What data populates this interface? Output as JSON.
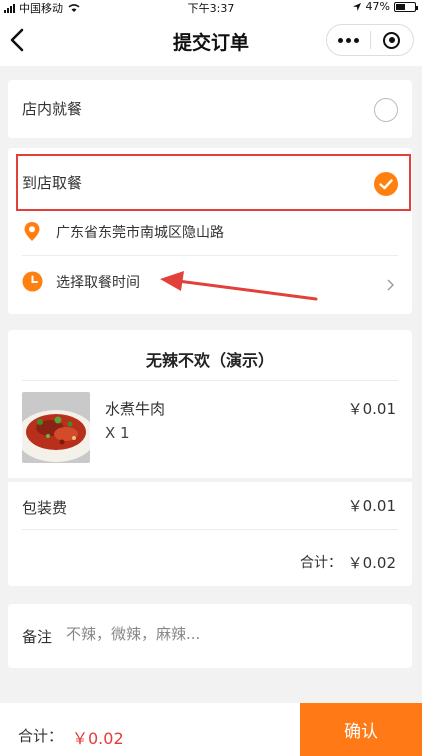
{
  "status_bar": {
    "carrier": "中国移动",
    "time": "下午3:37",
    "battery": "47%"
  },
  "navbar": {
    "title": "提交订单"
  },
  "dining_options": {
    "dine_in_label": "店内就餐",
    "pickup_label": "到店取餐",
    "selected": "pickup"
  },
  "pickup": {
    "address": "广东省东莞市南城区隐山路",
    "time_placeholder": "选择取餐时间"
  },
  "order": {
    "shop_name": "无辣不欢（演示）",
    "items": [
      {
        "name": "水煮牛肉",
        "quantity": "X 1",
        "price": "￥0.01"
      }
    ],
    "packaging_label": "包装费",
    "packaging_fee": "￥0.01",
    "subtotal_label": "合计：",
    "subtotal": "￥0.02"
  },
  "remark": {
    "label": "备注",
    "placeholder": "不辣，微辣，麻辣..."
  },
  "footer": {
    "total_label": "合计：",
    "total": "￥0.02",
    "confirm_label": "确认"
  },
  "colors": {
    "accent": "#ff7f0f",
    "highlight_box": "#e2403a",
    "total_price": "#e83a3a"
  }
}
